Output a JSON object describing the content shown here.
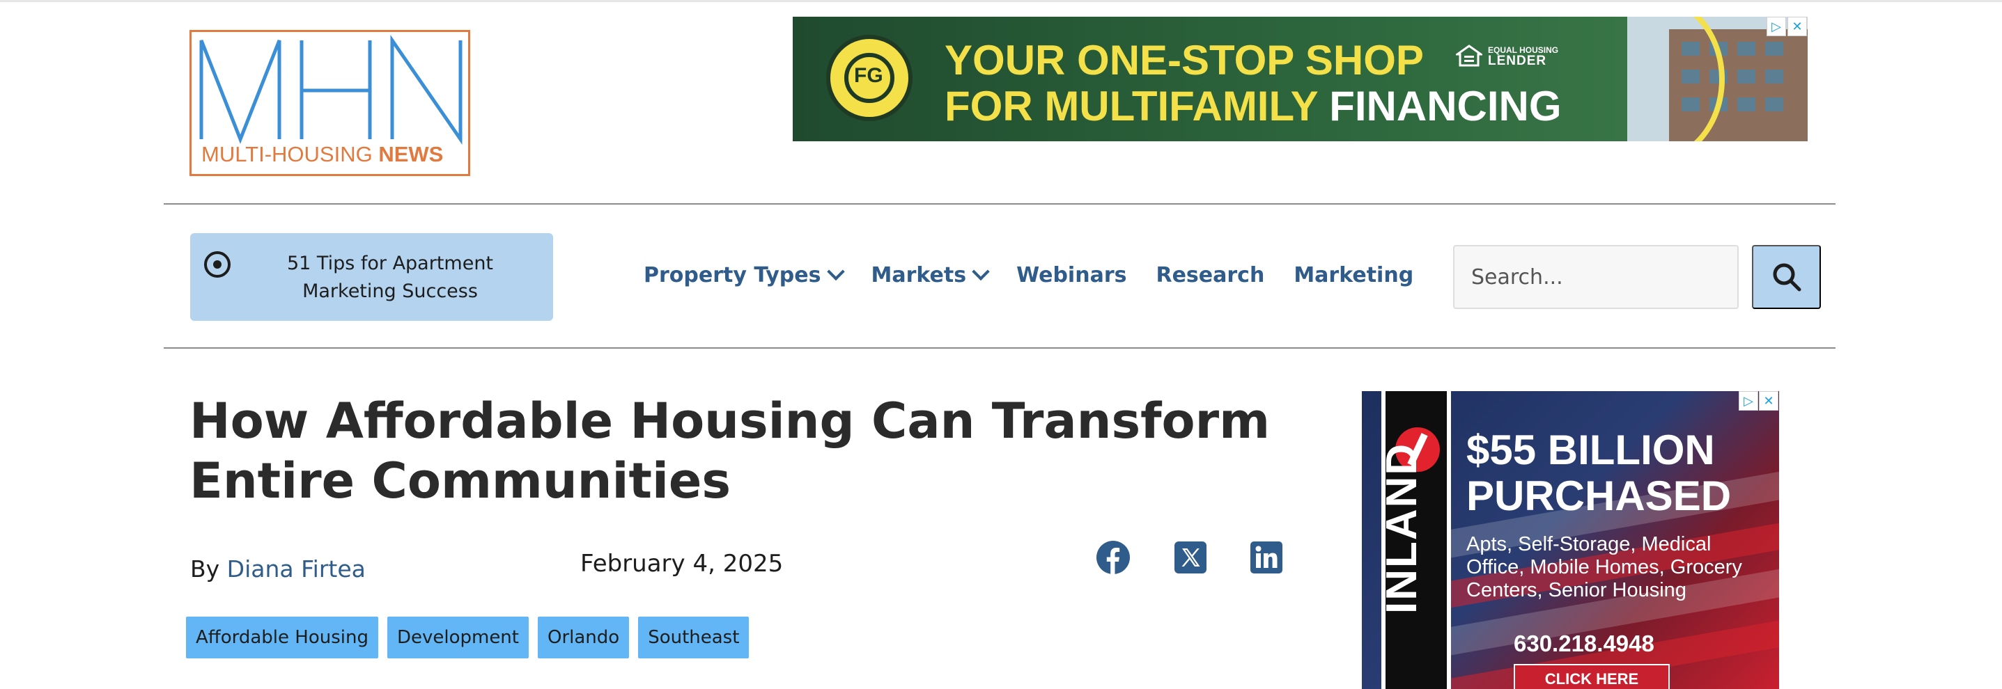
{
  "logo": {
    "letters": "MHN",
    "sub_plain": "MULTI-HOUSING ",
    "sub_bold": "NEWS"
  },
  "top_ad": {
    "seal_text": "FG",
    "line1": "YOUR ONE-STOP SHOP",
    "line2_a": "FOR MULTIFAMILY ",
    "line2_b": "FINANCING",
    "ehl_small": "EQUAL HOUSING",
    "ehl_big": "LENDER"
  },
  "featured_tip": {
    "text": "51 Tips for Apartment Marketing Success"
  },
  "nav": {
    "items": [
      {
        "label": "Property Types",
        "has_dropdown": true
      },
      {
        "label": "Markets",
        "has_dropdown": true
      },
      {
        "label": "Webinars",
        "has_dropdown": false
      },
      {
        "label": "Research",
        "has_dropdown": false
      },
      {
        "label": "Marketing",
        "has_dropdown": false
      }
    ]
  },
  "search": {
    "placeholder": "Search...",
    "value": ""
  },
  "article": {
    "headline": "How Affordable Housing Can Transform Entire Communities",
    "by": "By ",
    "author": "Diana Firtea",
    "date": "February 4, 2025",
    "tags": [
      "Affordable Housing",
      "Development",
      "Orlando",
      "Southeast"
    ]
  },
  "share": {
    "icons": [
      "facebook-icon",
      "x-twitter-icon",
      "linkedin-icon"
    ]
  },
  "side_ad": {
    "brand": "INLAND",
    "headline_1": "$55 BILLION",
    "headline_2": "PURCHASED",
    "details": "Apts, Self-Storage, Medical Office, Mobile Homes, Grocery Centers, Senior Housing",
    "phone": "630.218.4948",
    "cta": "CLICK HERE"
  },
  "colors": {
    "brand_blue": "#2f5c8a",
    "logo_blue": "#3a8fd6",
    "logo_orange": "#e07a3f",
    "tag_bg": "#63b6f5",
    "tip_bg": "#b3d3ef",
    "ad_green": "#2f6a3f",
    "ad_yellow": "#f4e14a"
  }
}
